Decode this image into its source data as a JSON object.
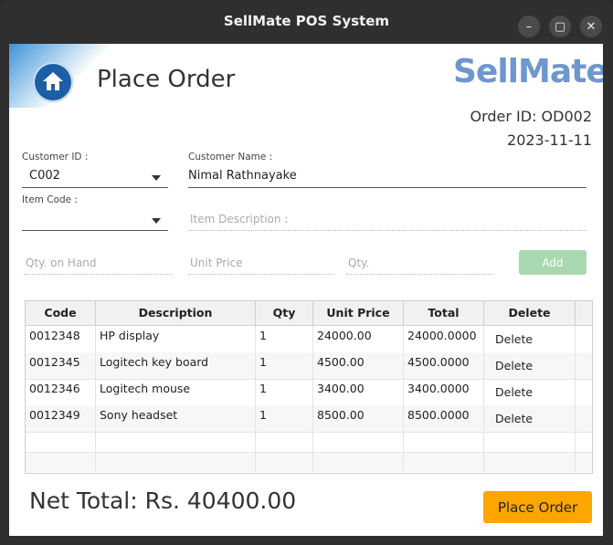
{
  "window": {
    "title": "SellMate POS System",
    "minimize_icon": "minimize-icon",
    "maximize_icon": "maximize-icon",
    "close_icon": "close-icon"
  },
  "header": {
    "heading": "Place Order",
    "logo": "SellMate",
    "order_id": "Order ID: OD002",
    "date": "2023-11-11"
  },
  "form": {
    "customer_id_label": "Customer ID :",
    "customer_id_value": "C002",
    "customer_name_label": "Customer Name :",
    "customer_name_value": "Nimal Rathnayake",
    "item_code_label": "Item Code :",
    "item_code_value": "",
    "item_description_placeholder": "Item Description :",
    "qty_on_hand_placeholder": "Qty. on Hand",
    "unit_price_placeholder": "Unit Price",
    "qty_placeholder": "Qty.",
    "add_label": "Add"
  },
  "table": {
    "columns": [
      "Code",
      "Description",
      "Qty",
      "Unit Price",
      "Total",
      "Delete"
    ],
    "rows": [
      {
        "code": "0012348",
        "description": "HP display",
        "qty": "1",
        "unit_price": "24000.00",
        "total": "24000.0000",
        "delete": "Delete"
      },
      {
        "code": "0012345",
        "description": "Logitech key board",
        "qty": "1",
        "unit_price": "4500.00",
        "total": "4500.0000",
        "delete": "Delete"
      },
      {
        "code": "0012346",
        "description": "Logitech mouse",
        "qty": "1",
        "unit_price": "3400.00",
        "total": "3400.0000",
        "delete": "Delete"
      },
      {
        "code": "0012349",
        "description": "Sony headset",
        "qty": "1",
        "unit_price": "8500.00",
        "total": "8500.0000",
        "delete": "Delete"
      }
    ]
  },
  "footer": {
    "net_total": "Net Total: Rs. 40400.00",
    "place_order_label": "Place Order"
  },
  "colors": {
    "accent": "#ffa500",
    "add_button": "#a8d8b0",
    "logo": "#6f96cf",
    "home_icon_bg": "#1d5fa6"
  }
}
